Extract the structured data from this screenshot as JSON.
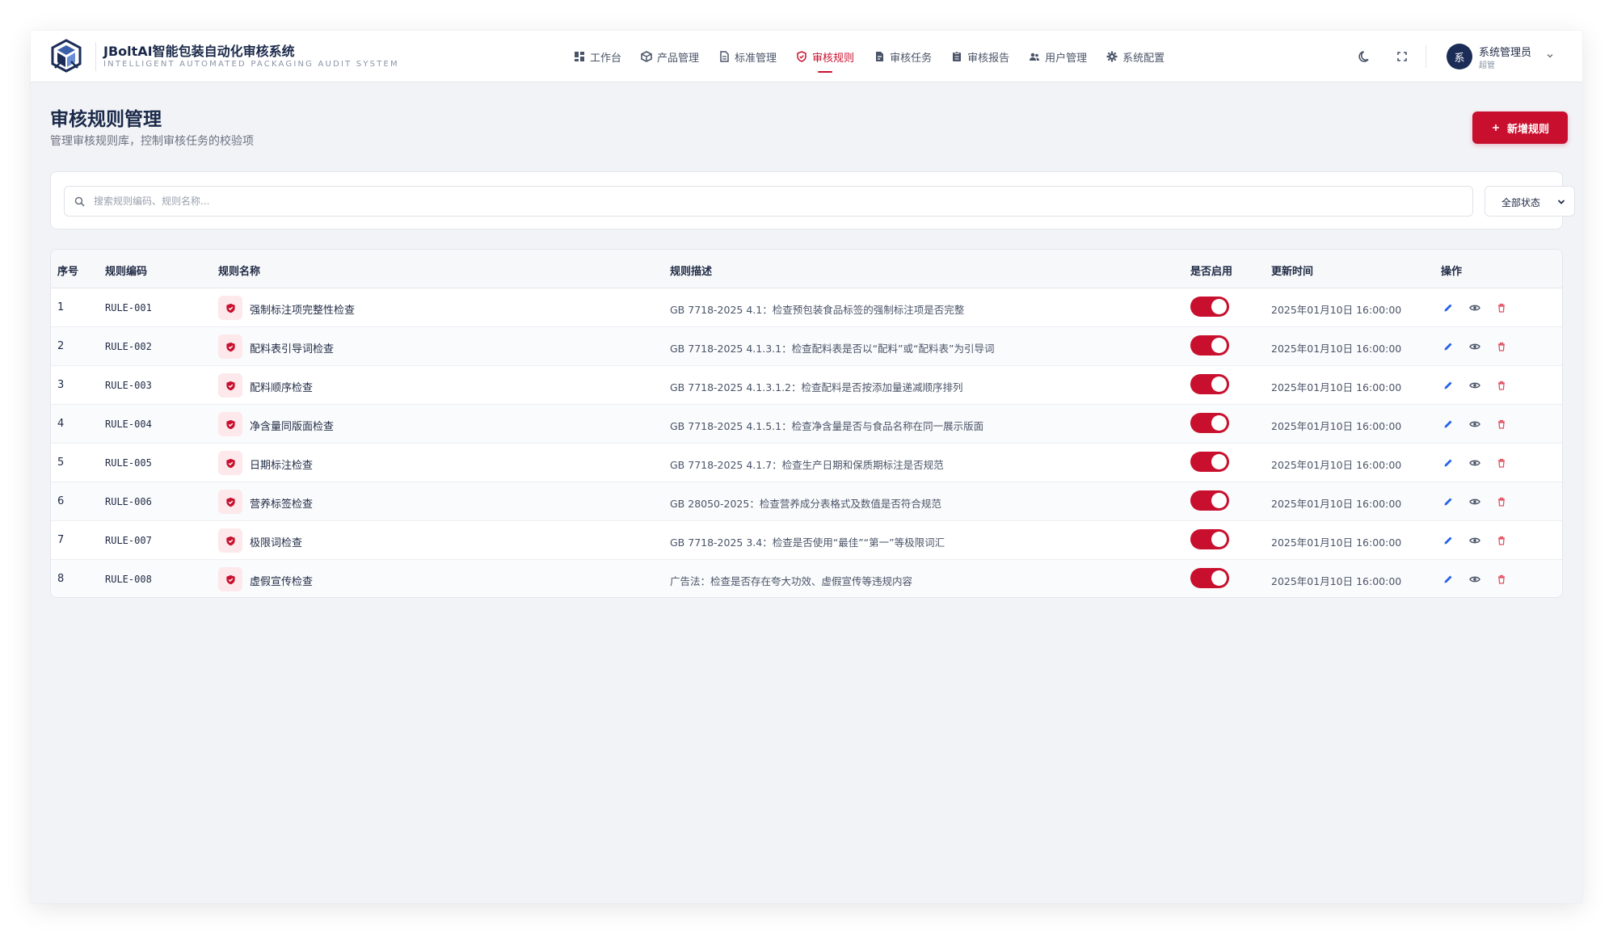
{
  "header": {
    "brand_title": "JBoltAI智能包装自动化审核系统",
    "brand_subtitle": "INTELLIGENT AUTOMATED PACKAGING AUDIT SYSTEM",
    "nav": [
      {
        "label": "工作台",
        "icon": "dashboard-icon"
      },
      {
        "label": "产品管理",
        "icon": "cube-icon"
      },
      {
        "label": "标准管理",
        "icon": "document-icon"
      },
      {
        "label": "审核规则",
        "icon": "shield-icon",
        "active": true
      },
      {
        "label": "审核任务",
        "icon": "task-icon"
      },
      {
        "label": "审核报告",
        "icon": "report-icon"
      },
      {
        "label": "用户管理",
        "icon": "users-icon"
      },
      {
        "label": "系统配置",
        "icon": "gear-icon"
      }
    ],
    "user": {
      "avatar_text": "系",
      "name": "系统管理员",
      "role": "超管"
    }
  },
  "page": {
    "title": "审核规则管理",
    "subtitle": "管理审核规则库，控制审核任务的校验项",
    "add_button_label": "新增规则"
  },
  "filters": {
    "search_placeholder": "搜索规则编码、规则名称...",
    "status_selected": "全部状态"
  },
  "table": {
    "columns": [
      "序号",
      "规则编码",
      "规则名称",
      "规则描述",
      "是否启用",
      "更新时间",
      "操作"
    ],
    "rows": [
      {
        "index": "1",
        "code": "RULE-001",
        "name": "强制标注项完整性检查",
        "desc": "GB 7718-2025 4.1：检查预包装食品标签的强制标注项是否完整",
        "enabled": true,
        "time": "2025年01月10日 16:00:00"
      },
      {
        "index": "2",
        "code": "RULE-002",
        "name": "配料表引导词检查",
        "desc": "GB 7718-2025 4.1.3.1：检查配料表是否以“配料”或“配料表”为引导词",
        "enabled": true,
        "time": "2025年01月10日 16:00:00"
      },
      {
        "index": "3",
        "code": "RULE-003",
        "name": "配料顺序检查",
        "desc": "GB 7718-2025 4.1.3.1.2：检查配料是否按添加量递减顺序排列",
        "enabled": true,
        "time": "2025年01月10日 16:00:00"
      },
      {
        "index": "4",
        "code": "RULE-004",
        "name": "净含量同版面检查",
        "desc": "GB 7718-2025 4.1.5.1：检查净含量是否与食品名称在同一展示版面",
        "enabled": true,
        "time": "2025年01月10日 16:00:00"
      },
      {
        "index": "5",
        "code": "RULE-005",
        "name": "日期标注检查",
        "desc": "GB 7718-2025 4.1.7：检查生产日期和保质期标注是否规范",
        "enabled": true,
        "time": "2025年01月10日 16:00:00"
      },
      {
        "index": "6",
        "code": "RULE-006",
        "name": "营养标签检查",
        "desc": "GB 28050-2025：检查营养成分表格式及数值是否符合规范",
        "enabled": true,
        "time": "2025年01月10日 16:00:00"
      },
      {
        "index": "7",
        "code": "RULE-007",
        "name": "极限词检查",
        "desc": "GB 7718-2025 3.4：检查是否使用“最佳”“第一”等极限词汇",
        "enabled": true,
        "time": "2025年01月10日 16:00:00"
      },
      {
        "index": "8",
        "code": "RULE-008",
        "name": "虚假宣传检查",
        "desc": "广告法：检查是否存在夸大功效、虚假宣传等违规内容",
        "enabled": true,
        "time": "2025年01月10日 16:00:00"
      }
    ]
  },
  "colors": {
    "accent": "#c8102e",
    "brand_dark": "#1b2d57",
    "edit": "#2563eb",
    "view": "#4a5468",
    "delete": "#e05565"
  }
}
